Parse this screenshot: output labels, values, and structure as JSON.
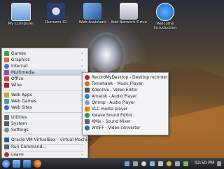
{
  "desktop_icons": [
    {
      "label": "My Computer",
      "icon": "monitor-icon",
      "color": "#7ab0e6"
    },
    {
      "label": "Runners-ID",
      "icon": "runners-logo-icon",
      "color": "#2b3d6b"
    },
    {
      "label": "Web Assistant",
      "icon": "web-assistant-icon",
      "color": "#3c6fb4"
    },
    {
      "label": "Add Network Drive",
      "icon": "network-drive-icon",
      "color": "#d8dde6"
    },
    {
      "label": "Welcome Introduction",
      "icon": "info-icon",
      "color": "#1e88e5"
    }
  ],
  "menu": {
    "items": [
      {
        "label": "Games",
        "icon": "games-icon",
        "color": "#4a9d3d",
        "arrow": "›"
      },
      {
        "label": "Graphics",
        "icon": "graphics-icon",
        "color": "#e0702a",
        "arrow": "›"
      },
      {
        "label": "Internet",
        "icon": "internet-icon",
        "color": "#3b78c8",
        "arrow": "›"
      },
      {
        "label": "Multimedia",
        "icon": "multimedia-icon",
        "color": "#8a4bb8",
        "arrow": "›",
        "active": true
      },
      {
        "label": "Office",
        "icon": "office-icon",
        "color": "#c94040",
        "arrow": "›"
      },
      {
        "label": "Wine",
        "icon": "wine-icon",
        "color": "#b32020",
        "arrow": "›"
      },
      {
        "label": "Web Apps",
        "icon": "web-apps-icon",
        "color": "#d8a020",
        "arrow": "›"
      },
      {
        "label": "Web Games",
        "icon": "web-games-icon",
        "color": "#40a0a0",
        "arrow": "›"
      },
      {
        "label": "Web Sites",
        "icon": "web-sites-icon",
        "color": "#3b6ec8",
        "arrow": "›"
      },
      {
        "label": "Utilities",
        "icon": "utilities-icon",
        "color": "#707070",
        "arrow": "›"
      },
      {
        "label": "System",
        "icon": "system-icon",
        "color": "#505a68",
        "arrow": "›"
      },
      {
        "label": "Settings",
        "icon": "settings-icon",
        "color": "#808890",
        "arrow": "›"
      },
      {
        "label": "Oracle VM VirtualBox - Virtual Machine",
        "icon": "virtualbox-icon",
        "color": "#2a5fa8",
        "arrow": ""
      },
      {
        "label": "Run Command...",
        "icon": "run-command-icon",
        "color": "#5a6270",
        "arrow": ""
      },
      {
        "label": "Leave",
        "icon": "leave-icon",
        "color": "#c03030",
        "arrow": "›"
      }
    ]
  },
  "submenu": {
    "items": [
      {
        "label": "RecordMyDesktop - Desktop recorder",
        "icon": "record-icon",
        "color": "#c02020"
      },
      {
        "label": "Tomahawk - Music Player",
        "icon": "tomahawk-icon",
        "color": "#e06020"
      },
      {
        "label": "Kdenlive - Video Editor",
        "icon": "kdenlive-icon",
        "color": "#505050"
      },
      {
        "label": "Amarok - Audio Player",
        "icon": "amarok-icon",
        "color": "#3a7ad0"
      },
      {
        "label": "Qmmp - Audio Player",
        "icon": "qmmp-icon",
        "color": "#7aa0c0"
      },
      {
        "label": "VLC media player",
        "icon": "vlc-icon",
        "color": "#f08000"
      },
      {
        "label": "Kwave Sound Editor",
        "icon": "kwave-icon",
        "color": "#3a9a3a"
      },
      {
        "label": "KMix - Sound Mixer",
        "icon": "kmix-icon",
        "color": "#606870"
      },
      {
        "label": "WinFF - Video converter",
        "icon": "winff-icon",
        "color": "#2a6ab0"
      }
    ]
  },
  "taskbar": {
    "clock": "02:50 PM",
    "launchers": [
      {
        "icon": "kde-start-icon",
        "color": "#3a80d8"
      },
      {
        "icon": "home-folder-icon",
        "color": "#5a9ae0"
      },
      {
        "icon": "dolphin-icon",
        "color": "#4a8ad0"
      },
      {
        "icon": "firefox-icon",
        "color": "#e07020"
      }
    ]
  }
}
